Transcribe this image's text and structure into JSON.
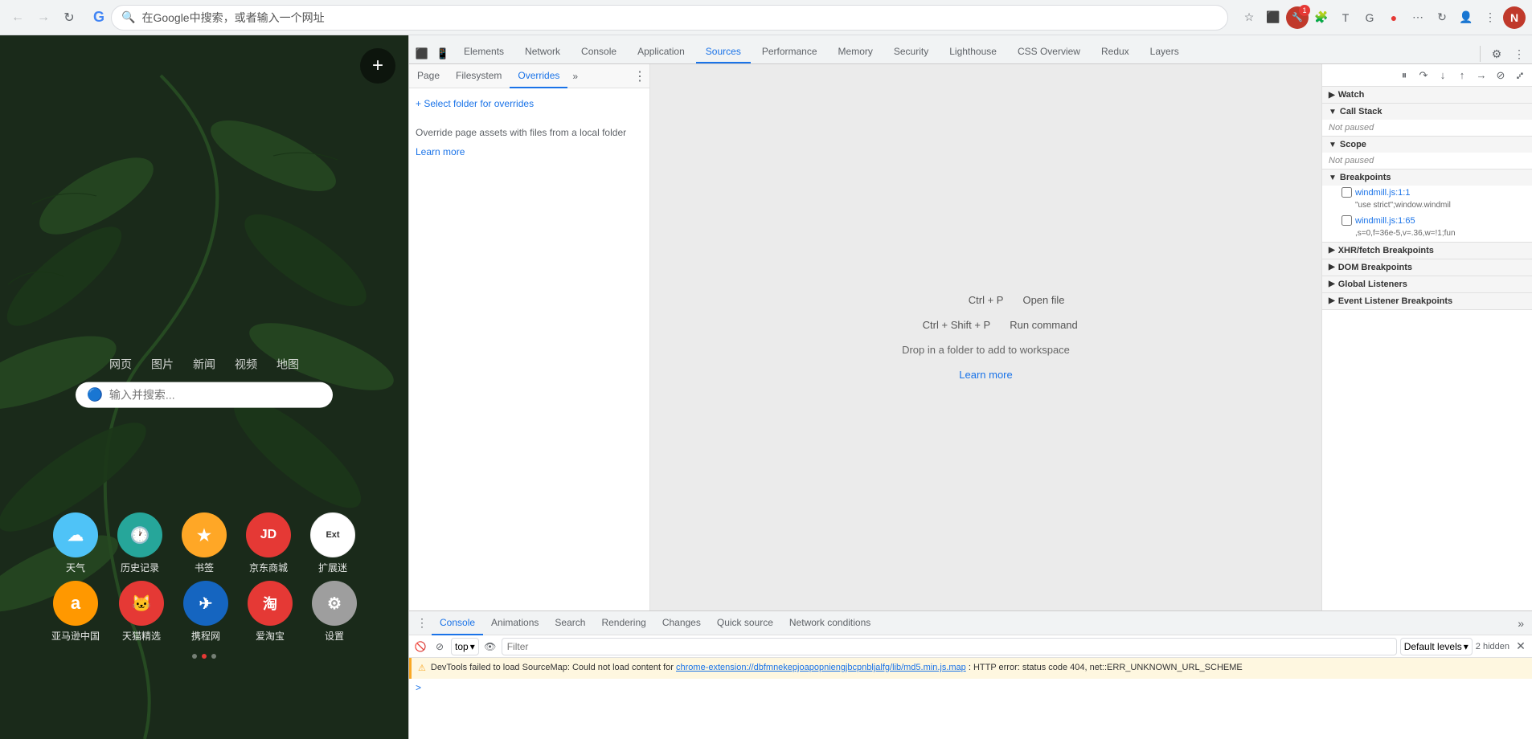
{
  "browser": {
    "address": "在Google中搜索，或者输入一个网址",
    "profile_letter": "N",
    "ext_badge": "1"
  },
  "page": {
    "search_nav": [
      "网页",
      "图片",
      "新闻",
      "视频",
      "地图"
    ],
    "search_placeholder": "输入并搜索...",
    "apps": [
      [
        {
          "label": "天气",
          "bg": "#4fc3f7",
          "icon": "☁"
        },
        {
          "label": "历史记录",
          "bg": "#26a69a",
          "icon": "🕐"
        },
        {
          "label": "书签",
          "bg": "#ffa726",
          "icon": "★"
        },
        {
          "label": "京东商城",
          "bg": "#e53935",
          "icon": "JD"
        },
        {
          "label": "扩展迷",
          "bg": "#fff",
          "icon": "Ext",
          "text_color": "#333"
        }
      ],
      [
        {
          "label": "亚马逊中国",
          "bg": "#ff9800",
          "icon": "a"
        },
        {
          "label": "天猫精选",
          "bg": "#e53935",
          "icon": "🐱"
        },
        {
          "label": "携程网",
          "bg": "#1565c0",
          "icon": "✈"
        },
        {
          "label": "爱淘宝",
          "bg": "#e53935",
          "icon": "淘"
        },
        {
          "label": "设置",
          "bg": "#9e9e9e",
          "icon": "⚙"
        }
      ]
    ]
  },
  "devtools": {
    "tabs": [
      "Elements",
      "Network",
      "Console",
      "Application",
      "Sources",
      "Performance",
      "Memory",
      "Security",
      "Lighthouse",
      "CSS Overview",
      "Redux",
      "Layers"
    ],
    "active_tab": "Sources",
    "subtabs": [
      "Page",
      "Filesystem",
      "Overrides"
    ],
    "active_subtab": "Overrides",
    "select_folder_label": "+ Select folder for overrides",
    "override_desc": "Override page assets with files from a local folder",
    "learn_more_overrides": "Learn more",
    "shortcuts": [
      {
        "key": "Ctrl + P",
        "desc": "Open file"
      },
      {
        "key": "Ctrl + Shift + P",
        "desc": "Run command"
      }
    ],
    "drop_text": "Drop in a folder to add to workspace",
    "learn_more_main": "Learn more",
    "debugger": {
      "watch_label": "Watch",
      "call_stack_label": "Call Stack",
      "call_stack_status": "Not paused",
      "scope_label": "Scope",
      "scope_status": "Not paused",
      "breakpoints_label": "Breakpoints",
      "breakpoints": [
        {
          "filename": "windmill.js:1:1",
          "code": "\"use strict\";window.windmil"
        },
        {
          "filename": "windmill.js:1:65",
          "code": ",s=0,f=36e-5,v=.36,w=!1;fun"
        }
      ],
      "xhr_fetch_label": "XHR/fetch Breakpoints",
      "dom_label": "DOM Breakpoints",
      "global_listeners_label": "Global Listeners",
      "event_listener_label": "Event Listener Breakpoints"
    }
  },
  "console": {
    "tabs": [
      "Console",
      "Animations",
      "Search",
      "Rendering",
      "Changes",
      "Quick source",
      "Network conditions"
    ],
    "active_tab": "Console",
    "toolbar": {
      "context_selector": "top",
      "filter_placeholder": "Filter",
      "levels_label": "Default levels"
    },
    "hidden_count": "2 hidden",
    "error_message": "DevTools failed to load SourceMap: Could not load content for chrome-extension://dbfmnekepjoapopniengjbcpnbljalfg/lib/md5.min.js.map: HTTP error: status code 404, net::ERR_UNKNOWN_URL_SCHEME",
    "error_link": "chrome-extension://dbfmnekepjoapopniengjbcpnbljalfg/lib/md5.min.js.map"
  }
}
